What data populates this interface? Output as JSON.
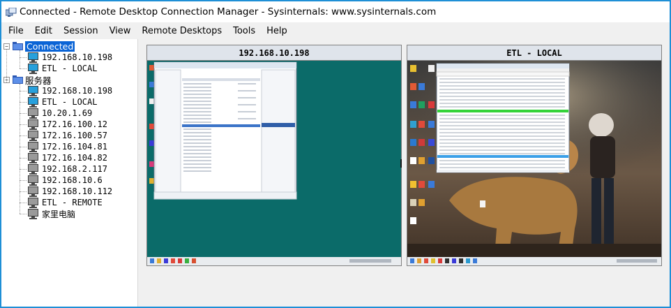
{
  "window": {
    "title": "Connected - Remote Desktop Connection Manager - Sysinternals: www.sysinternals.com"
  },
  "menu": [
    "File",
    "Edit",
    "Session",
    "View",
    "Remote Desktops",
    "Tools",
    "Help"
  ],
  "tree": {
    "groups": [
      {
        "label": "Connected",
        "expanded": true,
        "selected": true,
        "servers": [
          {
            "label": "192.168.10.198",
            "connected": true
          },
          {
            "label": "ETL - LOCAL",
            "connected": true
          }
        ]
      },
      {
        "label": "服务器",
        "expanded": true,
        "selected": false,
        "servers": [
          {
            "label": "192.168.10.198",
            "connected": true
          },
          {
            "label": "ETL - LOCAL",
            "connected": true
          },
          {
            "label": "10.20.1.69",
            "connected": false
          },
          {
            "label": "172.16.100.12",
            "connected": false
          },
          {
            "label": "172.16.100.57",
            "connected": false
          },
          {
            "label": "172.16.104.81",
            "connected": false
          },
          {
            "label": "172.16.104.82",
            "connected": false
          },
          {
            "label": "192.168.2.117",
            "connected": false
          },
          {
            "label": "192.168.10.6",
            "connected": false
          },
          {
            "label": "192.168.10.112",
            "connected": false
          },
          {
            "label": "ETL - REMOTE",
            "connected": false
          },
          {
            "label": "家里电脑",
            "connected": false
          }
        ]
      }
    ]
  },
  "thumbnails": [
    {
      "title": "192.168.10.198"
    },
    {
      "title": "ETL - LOCAL"
    }
  ],
  "colors": {
    "window_border": "#1e8fd6",
    "selection": "#0a64d6",
    "connected_icon": "#28a0dc",
    "disconnected_icon": "#9a9a9a",
    "server_desktop": "#0b6b69"
  }
}
